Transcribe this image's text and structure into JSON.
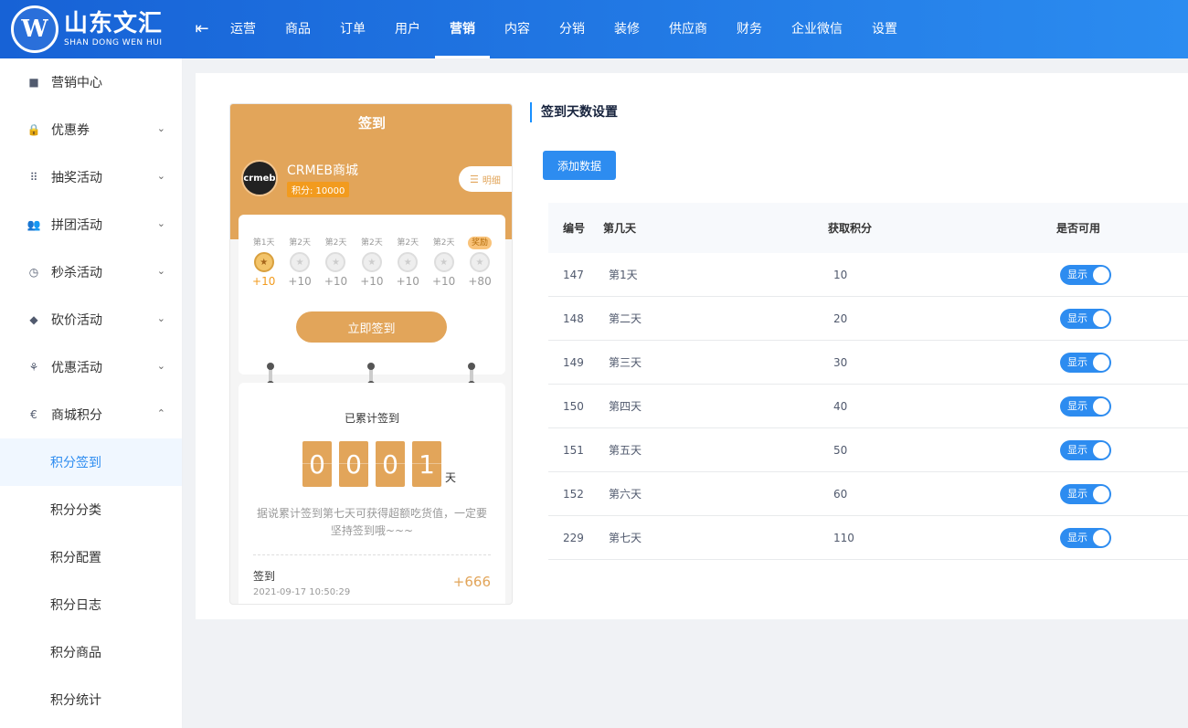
{
  "brand": {
    "name_cn": "山东文汇",
    "name_en": "SHAN DONG WEN HUI",
    "mark": "W"
  },
  "nav": [
    "运营",
    "商品",
    "订单",
    "用户",
    "营销",
    "内容",
    "分销",
    "装修",
    "供应商",
    "财务",
    "企业微信",
    "设置"
  ],
  "nav_active": "营销",
  "sidebar": {
    "items": [
      {
        "label": "营销中心",
        "icon": "square-icon",
        "glyph": "■",
        "arrow": ""
      },
      {
        "label": "优惠券",
        "icon": "lock-icon",
        "glyph": "🔒",
        "arrow": "⌄"
      },
      {
        "label": "抽奖活动",
        "icon": "grid-icon",
        "glyph": "⠿",
        "arrow": "⌄"
      },
      {
        "label": "拼团活动",
        "icon": "group-icon",
        "glyph": "👥",
        "arrow": "⌄"
      },
      {
        "label": "秒杀活动",
        "icon": "clock-icon",
        "glyph": "◷",
        "arrow": "⌄"
      },
      {
        "label": "砍价活动",
        "icon": "tag-icon",
        "glyph": "◆",
        "arrow": "⌄"
      },
      {
        "label": "优惠活动",
        "icon": "discount-icon",
        "glyph": "⚘",
        "arrow": "⌄"
      },
      {
        "label": "商城积分",
        "icon": "euro-icon",
        "glyph": "€",
        "arrow": "⌃"
      }
    ],
    "sub_items": [
      "积分签到",
      "积分分类",
      "积分配置",
      "积分日志",
      "积分商品",
      "积分统计"
    ],
    "active_sub": "积分签到"
  },
  "preview": {
    "title": "签到",
    "avatar_text": "crmeb",
    "shop_name": "CRMEB商城",
    "points_badge": "积分: 10000",
    "detail_btn": "明细",
    "days": [
      {
        "label": "第1天",
        "points": "+10",
        "done": true,
        "reward": false
      },
      {
        "label": "第2天",
        "points": "+10",
        "done": false,
        "reward": false
      },
      {
        "label": "第2天",
        "points": "+10",
        "done": false,
        "reward": false
      },
      {
        "label": "第2天",
        "points": "+10",
        "done": false,
        "reward": false
      },
      {
        "label": "第2天",
        "points": "+10",
        "done": false,
        "reward": false
      },
      {
        "label": "第2天",
        "points": "+10",
        "done": false,
        "reward": false
      },
      {
        "label": "奖励",
        "points": "+80",
        "done": false,
        "reward": true
      }
    ],
    "sign_btn": "立即签到",
    "total_title": "已累计签到",
    "digits": [
      "0",
      "0",
      "0",
      "1"
    ],
    "digit_unit": "天",
    "tip": "据说累计签到第七天可获得超额吃货值，一定要坚持签到哦~~~",
    "record": {
      "title": "签到",
      "time": "2021-09-17 10:50:29",
      "points": "+666"
    }
  },
  "section_title": "签到天数设置",
  "add_btn": "添加数据",
  "table": {
    "headers": {
      "id": "编号",
      "day": "第几天",
      "points": "获取积分",
      "usable": "是否可用"
    },
    "rows": [
      {
        "id": "147",
        "day": "第1天",
        "points": "10",
        "status": "显示"
      },
      {
        "id": "148",
        "day": "第二天",
        "points": "20",
        "status": "显示"
      },
      {
        "id": "149",
        "day": "第三天",
        "points": "30",
        "status": "显示"
      },
      {
        "id": "150",
        "day": "第四天",
        "points": "40",
        "status": "显示"
      },
      {
        "id": "151",
        "day": "第五天",
        "points": "50",
        "status": "显示"
      },
      {
        "id": "152",
        "day": "第六天",
        "points": "60",
        "status": "显示"
      },
      {
        "id": "229",
        "day": "第七天",
        "points": "110",
        "status": "显示"
      }
    ]
  },
  "colors": {
    "primary": "#2d8cf0",
    "accent": "#e2a55a",
    "header_start": "#1762d6",
    "header_end": "#2b8cf0"
  }
}
